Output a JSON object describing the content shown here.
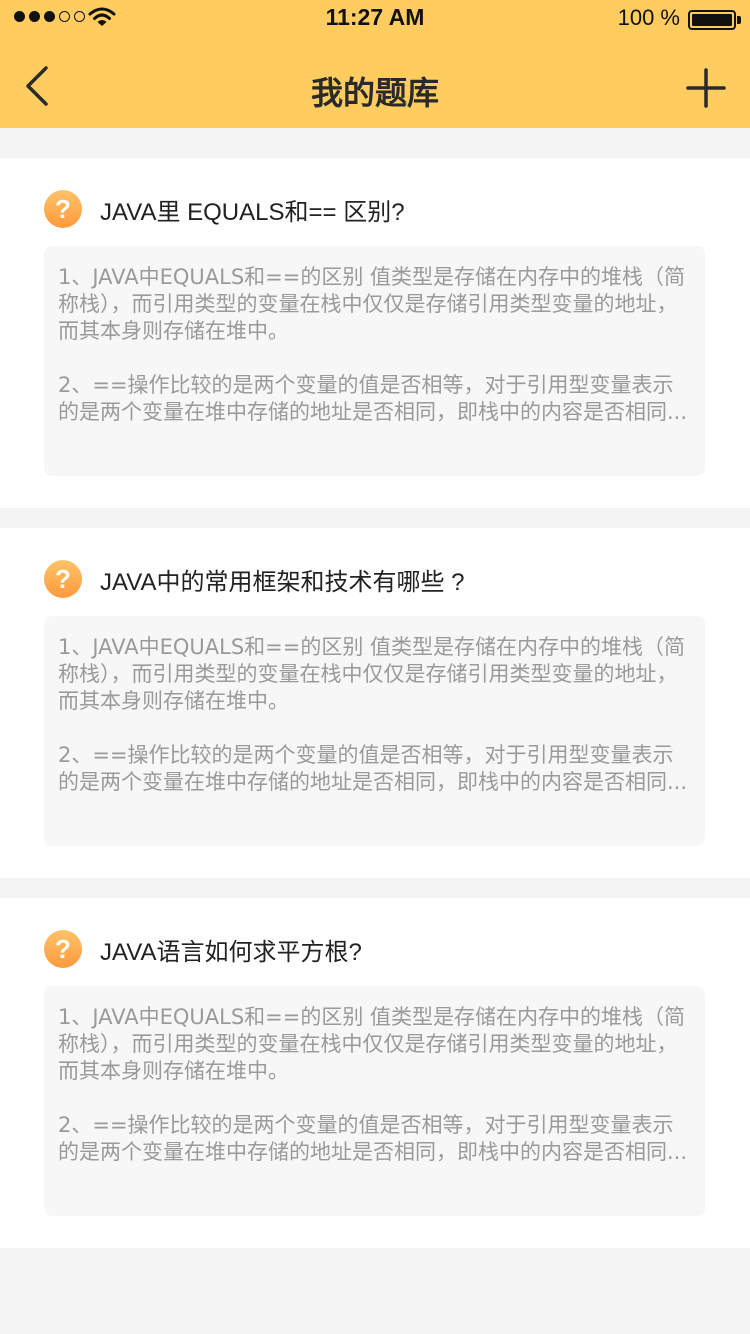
{
  "status_bar": {
    "time": "11:27 AM",
    "battery": "100 %",
    "icons": [
      "signal-icon",
      "wifi-icon",
      "battery-icon"
    ]
  },
  "nav": {
    "title": "我的题库",
    "back_icon": "chevron-left-icon",
    "add_icon": "plus-icon"
  },
  "colors": {
    "header": "#ffcc5f",
    "question_icon": "#ffa94a",
    "answer_text": "#9a9a9a",
    "background": "#f4f4f4"
  },
  "questions": [
    {
      "icon": "?",
      "title": "JAVA里 EQUALS和== 区别?",
      "answer_p1": "1、JAVA中EQUALS和==的区别 值类型是存储在内存中的堆栈（简称栈），而引用类型的变量在栈中仅仅是存储引用类型变量的地址，而其本身则存储在堆中。",
      "answer_p2": "2、==操作比较的是两个变量的值是否相等，对于引用型变量表示的是两个变量在堆中存储的地址是否相同，即栈中的内容是否相同..."
    },
    {
      "icon": "?",
      "title": "JAVA中的常用框架和技术有哪些 ?",
      "answer_p1": "1、JAVA中EQUALS和==的区别 值类型是存储在内存中的堆栈（简称栈），而引用类型的变量在栈中仅仅是存储引用类型变量的地址，而其本身则存储在堆中。",
      "answer_p2": "2、==操作比较的是两个变量的值是否相等，对于引用型变量表示的是两个变量在堆中存储的地址是否相同，即栈中的内容是否相同..."
    },
    {
      "icon": "?",
      "title": "JAVA语言如何求平方根?",
      "answer_p1": "1、JAVA中EQUALS和==的区别 值类型是存储在内存中的堆栈（简称栈），而引用类型的变量在栈中仅仅是存储引用类型变量的地址，而其本身则存储在堆中。",
      "answer_p2": "2、==操作比较的是两个变量的值是否相等，对于引用型变量表示的是两个变量在堆中存储的地址是否相同，即栈中的内容是否相同..."
    }
  ]
}
